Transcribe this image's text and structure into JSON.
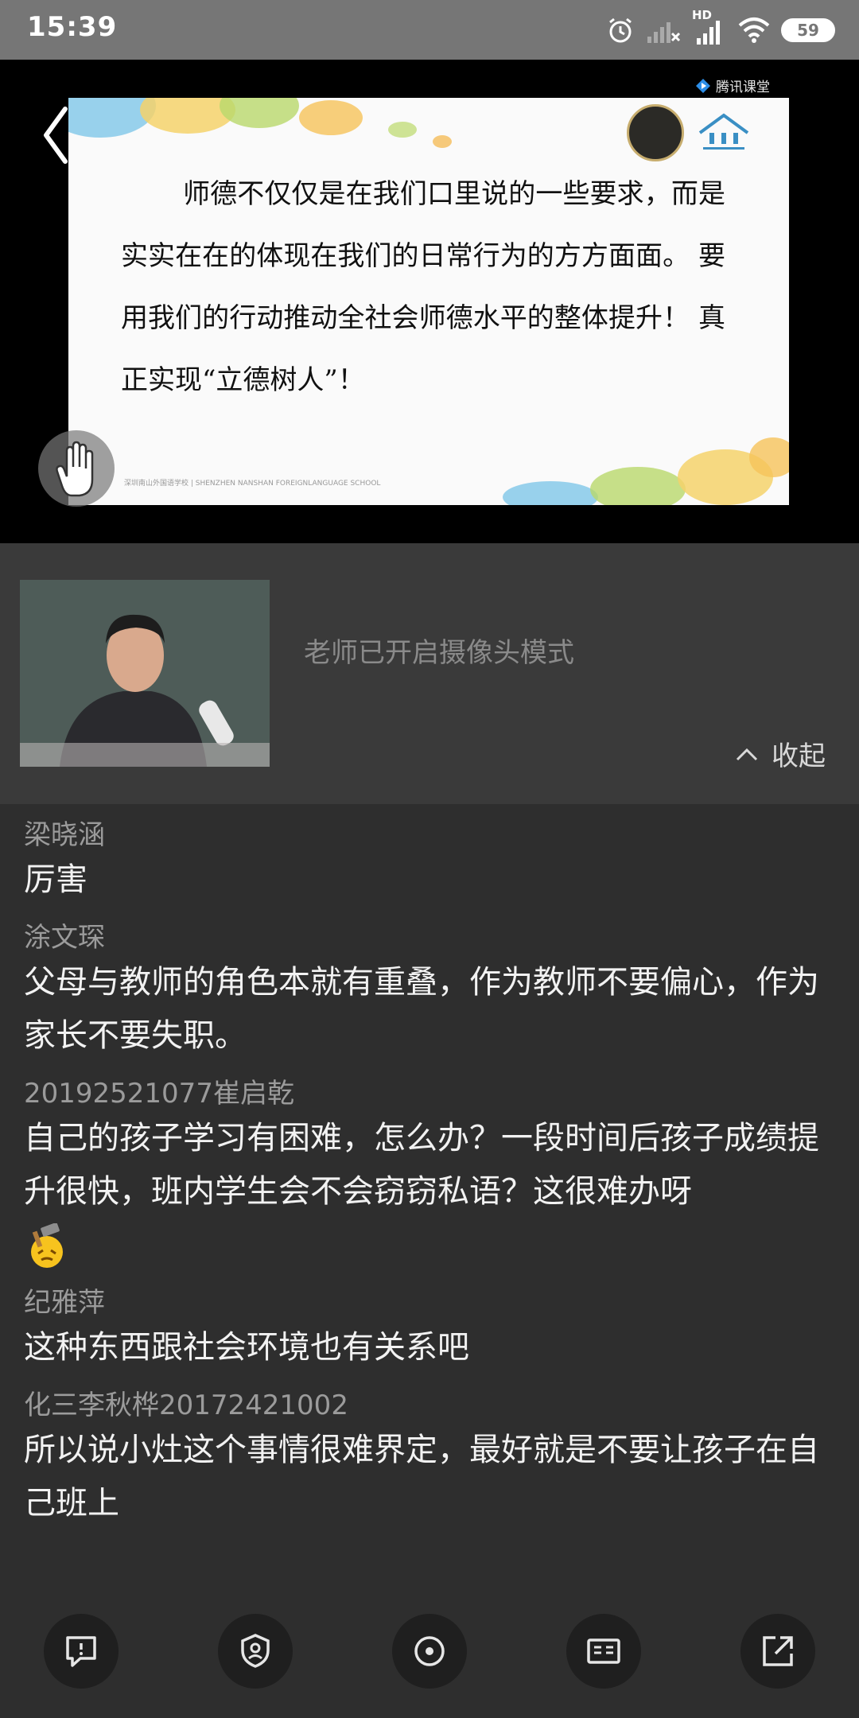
{
  "status_bar": {
    "time": "15:39",
    "network_label": "HD",
    "battery": "59",
    "icons": [
      "alarm-icon",
      "signal-empty-icon",
      "signal-icon",
      "wifi-icon",
      "battery-icon"
    ]
  },
  "player": {
    "brand": "腾讯课堂",
    "slide_text": "师德不仅仅是在我们口里说的一些要求，而是实实在在的体现在我们的日常行为的方方面面。 要用我们的行动推动全社会师德水平的整体提升！ 真正实现“立德树人”！",
    "slide_footer": "深圳南山外国语学校 | SHENZHEN NANSHAN FOREIGNLANGUAGE SCHOOL"
  },
  "camera": {
    "status": "老师已开启摄像头模式",
    "collapse_label": "收起"
  },
  "chat": {
    "messages": [
      {
        "sender": "梁晓涵",
        "content": "厉害"
      },
      {
        "sender": "涂文琛",
        "content": "父母与教师的角色本就有重叠，作为教师不要偏心，作为家长不要失职。"
      },
      {
        "sender": "20192521077崔启乾",
        "content": "自己的孩子学习有困难，怎么办？一段时间后孩子成绩提升很快，班内学生会不会窃窃私语？这很难办呀"
      },
      {
        "sender": "纪雅萍",
        "content": "这种东西跟社会环境也有关系吧"
      },
      {
        "sender": "化三李秋桦20172421002",
        "content": "所以说小灶这个事情很难界定，最好就是不要让孩子在自己班上"
      }
    ]
  },
  "toolbar": {
    "buttons": [
      "chat-bubble-icon",
      "shield-icon",
      "target-icon",
      "id-card-icon",
      "share-icon"
    ]
  },
  "colors": {
    "status_bar": "#767676",
    "background": "#2e2e2e",
    "camera_panel": "#3a3a3a",
    "sender": "#9b9b9b",
    "message": "#f2f2f2"
  }
}
